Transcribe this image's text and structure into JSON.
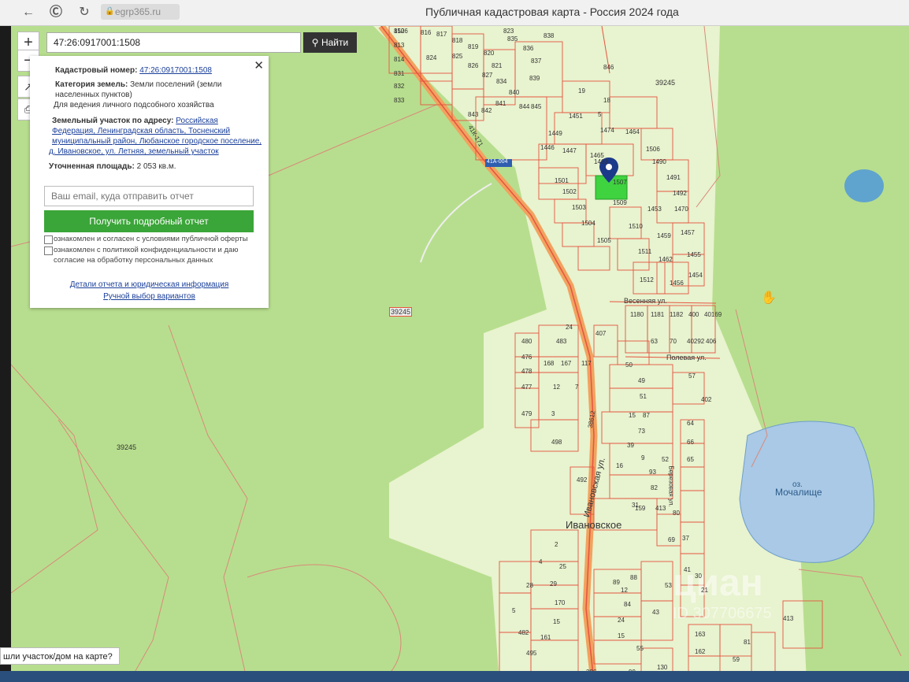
{
  "browser": {
    "url": "egrp365.ru",
    "title": "Публичная кадастровая карта - Россия 2024 года"
  },
  "search": {
    "value": "47:26:0917001:1508",
    "button": "Найти"
  },
  "zoom": {
    "in": "+",
    "out": "−"
  },
  "info": {
    "cad_label": "Кадастровый номер:",
    "cad_value": "47:26:0917001:1508",
    "category_label": "Категория земель:",
    "category_value_1": "Земли поселений (земли",
    "category_value_2": "населенных пунктов)",
    "use": "Для ведения личного подсобного хозяйства",
    "address_label": "Земельный участок по адресу:",
    "address_1": "Российская",
    "address_2": "Федерация, Ленинградская область, Тосненский",
    "address_3": "муниципальный район, Любанское городское поселение,",
    "address_4": "д. Ивановское, ул. Летняя, земельный участок",
    "area_label": "Уточненная площадь:",
    "area_value": "2 053 кв.м.",
    "email_placeholder": "Ваш email, куда отправить отчет",
    "report_button": "Получить подробный отчет",
    "consent_1": "ознакомлен и согласен с условиями публичной оферты",
    "consent_2a": "ознакомлен с политикой конфиденциальности и даю",
    "consent_2b": "согласие на обработку персональных данных",
    "details_link": "Детали отчета и юридическая информация",
    "manual_link": "Ручной выбор вариантов"
  },
  "map": {
    "labels": {
      "zone_a": "39245",
      "zone_b": "39245",
      "zone_c": "39245",
      "road_a": "41А-004",
      "road_b": "41К-171",
      "road_c": "38612",
      "street_1": "Весенняя ул.",
      "street_2": "Полевая ул.",
      "street_3": "Ивановская ул.",
      "street_4": "Березовая ул.",
      "village": "Ивановское",
      "lake": "оз.",
      "lake_name": "Мочалище",
      "watermark": "циан",
      "watermark_id": "ID 307706675"
    },
    "parcels": [
      "812",
      "813",
      "814",
      "831",
      "832",
      "833",
      "816",
      "817",
      "818",
      "819",
      "820",
      "821",
      "823",
      "824",
      "825",
      "826",
      "827",
      "834",
      "835",
      "836",
      "837",
      "838",
      "839",
      "840",
      "841",
      "842",
      "843",
      "844",
      "845",
      "846",
      "19",
      "18",
      "1451",
      "1474",
      "1464",
      "1449",
      "1446",
      "1447",
      "1506",
      "1463",
      "1490",
      "1507",
      "1491",
      "1492",
      "1501",
      "1502",
      "1503",
      "1504",
      "1505",
      "1509",
      "1510",
      "1453",
      "1470",
      "1511",
      "1459",
      "1457",
      "1512",
      "1462",
      "1455",
      "1456",
      "1454",
      "1180",
      "1181",
      "1182",
      "400",
      "40169",
      "63",
      "70",
      "40292",
      "406",
      "480",
      "483",
      "24",
      "407",
      "476",
      "478",
      "477",
      "479",
      "168",
      "167",
      "117",
      "50",
      "49",
      "51",
      "12",
      "7",
      "3",
      "498",
      "15",
      "87",
      "73",
      "64",
      "66",
      "65",
      "9",
      "52",
      "93",
      "82",
      "39",
      "16",
      "492",
      "31",
      "159",
      "413",
      "80",
      "37",
      "69",
      "41",
      "2",
      "4",
      "25",
      "29",
      "170",
      "15",
      "161",
      "89",
      "88",
      "12",
      "84",
      "24",
      "43",
      "15",
      "55",
      "53",
      "30",
      "21",
      "28",
      "5",
      "482",
      "495",
      "474",
      "396",
      "99",
      "130",
      "163",
      "162",
      "81",
      "59",
      "57",
      "402",
      "413",
      "5",
      "1465",
      "1506"
    ]
  },
  "tooltip": "шли участок/дом на карте?"
}
